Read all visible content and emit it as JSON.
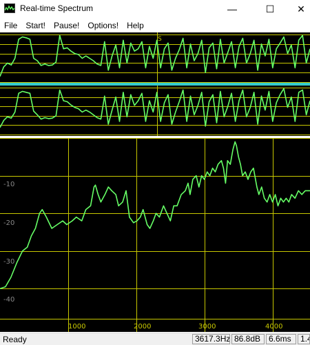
{
  "window": {
    "title": "Real-time Spectrum",
    "minimize_glyph": "—",
    "maximize_glyph": "☐",
    "close_glyph": "✕"
  },
  "menu": [
    "File",
    "Start!",
    "Pause!",
    "Options!",
    "Help"
  ],
  "waveform": {
    "marker_label": "S",
    "channel_colors": {
      "trace": "#66ff66",
      "grid": "#c8c800",
      "divider": "#33cccc"
    },
    "channel1": [
      0.12,
      0.32,
      0.4,
      0.36,
      0.5,
      0.9,
      0.95,
      0.93,
      0.9,
      0.5,
      0.45,
      0.35,
      0.38,
      0.35,
      0.36,
      0.42,
      0.98,
      0.7,
      0.72,
      0.65,
      0.6,
      0.58,
      0.5,
      0.55,
      0.5,
      0.45,
      0.38,
      0.35,
      0.85,
      0.25,
      0.55,
      0.78,
      0.3,
      0.88,
      0.4,
      0.82,
      0.65,
      0.7,
      0.85,
      0.3,
      0.75,
      0.5,
      0.88,
      0.3,
      0.7,
      0.82,
      0.25,
      0.5,
      0.68,
      0.92,
      0.3,
      0.8,
      0.45,
      0.6,
      0.88,
      0.2,
      0.72,
      0.82,
      0.28,
      0.9,
      0.4,
      0.62,
      0.85,
      0.3,
      0.75,
      0.92,
      0.4,
      0.6,
      0.88,
      0.25,
      0.8,
      0.55,
      0.9,
      0.3,
      0.7,
      0.82,
      0.95,
      0.6,
      0.78,
      0.3,
      0.88,
      0.98,
      0.4,
      0.7
    ],
    "channel2": [
      0.15,
      0.3,
      0.38,
      0.35,
      0.48,
      0.88,
      0.92,
      0.9,
      0.88,
      0.5,
      0.42,
      0.33,
      0.36,
      0.34,
      0.35,
      0.4,
      0.95,
      0.72,
      0.7,
      0.63,
      0.58,
      0.55,
      0.48,
      0.52,
      0.48,
      0.42,
      0.36,
      0.33,
      0.82,
      0.22,
      0.52,
      0.8,
      0.28,
      0.9,
      0.38,
      0.85,
      0.62,
      0.72,
      0.88,
      0.28,
      0.72,
      0.48,
      0.9,
      0.28,
      0.68,
      0.85,
      0.22,
      0.48,
      0.7,
      0.95,
      0.28,
      0.82,
      0.42,
      0.62,
      0.9,
      0.18,
      0.7,
      0.85,
      0.25,
      0.92,
      0.38,
      0.6,
      0.88,
      0.28,
      0.72,
      0.95,
      0.38,
      0.58,
      0.9,
      0.22,
      0.82,
      0.52,
      0.92,
      0.28,
      0.68,
      0.85,
      0.98,
      0.58,
      0.8,
      0.28,
      0.9,
      0.95,
      0.42,
      0.72
    ]
  },
  "spectrum": {
    "x_ticks": [
      "1000",
      "2000",
      "3000",
      "4000"
    ],
    "y_ticks": [
      "-10",
      "-20",
      "-30",
      "-40"
    ],
    "trace_color": "#66ff66",
    "grid_color": "#c8c800",
    "x_range_hz": [
      0,
      4550
    ],
    "y_range_db": [
      -48,
      0
    ],
    "points": [
      [
        0,
        -40
      ],
      [
        80,
        -39.5
      ],
      [
        160,
        -37
      ],
      [
        250,
        -33
      ],
      [
        330,
        -30
      ],
      [
        400,
        -29
      ],
      [
        460,
        -26
      ],
      [
        520,
        -24
      ],
      [
        580,
        -20
      ],
      [
        620,
        -19
      ],
      [
        680,
        -21
      ],
      [
        760,
        -24
      ],
      [
        840,
        -23
      ],
      [
        920,
        -22
      ],
      [
        980,
        -23
      ],
      [
        1060,
        -22
      ],
      [
        1120,
        -21
      ],
      [
        1200,
        -22
      ],
      [
        1260,
        -19
      ],
      [
        1330,
        -18
      ],
      [
        1380,
        -13
      ],
      [
        1400,
        -12.5
      ],
      [
        1440,
        -15
      ],
      [
        1480,
        -17
      ],
      [
        1540,
        -15
      ],
      [
        1590,
        -13
      ],
      [
        1640,
        -14
      ],
      [
        1700,
        -15
      ],
      [
        1740,
        -18
      ],
      [
        1800,
        -17
      ],
      [
        1850,
        -14
      ],
      [
        1900,
        -21
      ],
      [
        1960,
        -22.5
      ],
      [
        2010,
        -22
      ],
      [
        2060,
        -21
      ],
      [
        2100,
        -19
      ],
      [
        2160,
        -23
      ],
      [
        2200,
        -24
      ],
      [
        2250,
        -22
      ],
      [
        2290,
        -20
      ],
      [
        2340,
        -21
      ],
      [
        2400,
        -18
      ],
      [
        2450,
        -20
      ],
      [
        2500,
        -22
      ],
      [
        2550,
        -18
      ],
      [
        2600,
        -18
      ],
      [
        2660,
        -15
      ],
      [
        2720,
        -14
      ],
      [
        2760,
        -12
      ],
      [
        2790,
        -15
      ],
      [
        2830,
        -11
      ],
      [
        2880,
        -10
      ],
      [
        2920,
        -13
      ],
      [
        2960,
        -10
      ],
      [
        3000,
        -11
      ],
      [
        3040,
        -9
      ],
      [
        3080,
        -10
      ],
      [
        3120,
        -8
      ],
      [
        3160,
        -9
      ],
      [
        3200,
        -7
      ],
      [
        3250,
        -6
      ],
      [
        3280,
        -8
      ],
      [
        3310,
        -12
      ],
      [
        3340,
        -6
      ],
      [
        3380,
        -7
      ],
      [
        3420,
        -3
      ],
      [
        3450,
        -1
      ],
      [
        3470,
        -2
      ],
      [
        3500,
        -5
      ],
      [
        3530,
        -7
      ],
      [
        3560,
        -10
      ],
      [
        3600,
        -9
      ],
      [
        3640,
        -11
      ],
      [
        3680,
        -9
      ],
      [
        3720,
        -8
      ],
      [
        3770,
        -13
      ],
      [
        3800,
        -15
      ],
      [
        3840,
        -13
      ],
      [
        3880,
        -16
      ],
      [
        3920,
        -17
      ],
      [
        3960,
        -15
      ],
      [
        4000,
        -17
      ],
      [
        4040,
        -15
      ],
      [
        4080,
        -18
      ],
      [
        4120,
        -16
      ],
      [
        4160,
        -17
      ],
      [
        4200,
        -16
      ],
      [
        4240,
        -17
      ],
      [
        4280,
        -15
      ],
      [
        4330,
        -16
      ],
      [
        4380,
        -14
      ],
      [
        4430,
        -15
      ],
      [
        4480,
        -14
      ],
      [
        4550,
        -14
      ]
    ]
  },
  "status": {
    "ready": "Ready",
    "frequency": "3617.3Hz",
    "level": "86.8dB",
    "time": "6.6ms",
    "extra": "1.4"
  }
}
